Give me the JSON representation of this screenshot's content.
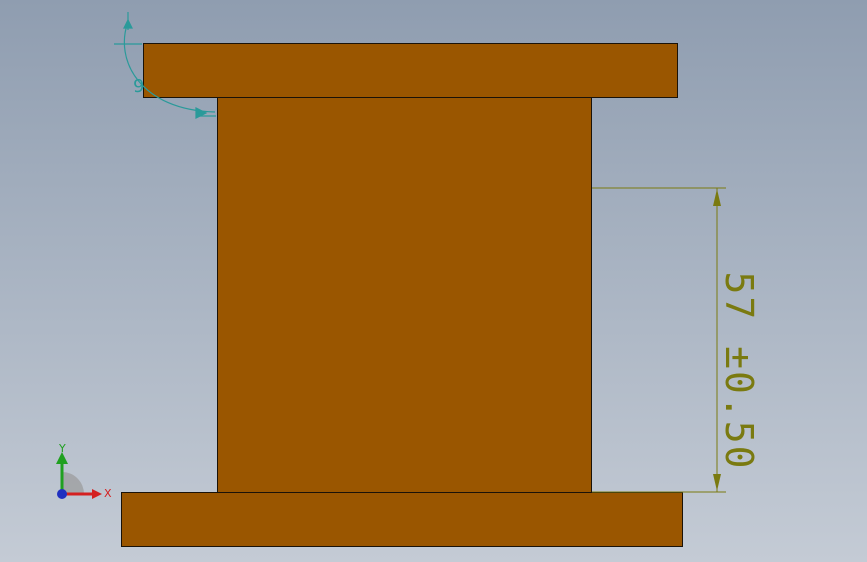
{
  "dimension": {
    "value": "57",
    "tolerance": "±0.50",
    "color": "#7a7a10"
  },
  "triad": {
    "x_label": "X",
    "y_label": "Y",
    "x_color": "#d42020",
    "y_color": "#20a020",
    "z_color": "#2030c0"
  },
  "part": {
    "fill_color": "#9a5600",
    "edge_color": "#1a1208"
  },
  "background": {
    "top_color": "#8f9db0",
    "bottom_color": "#c4cbd5"
  }
}
